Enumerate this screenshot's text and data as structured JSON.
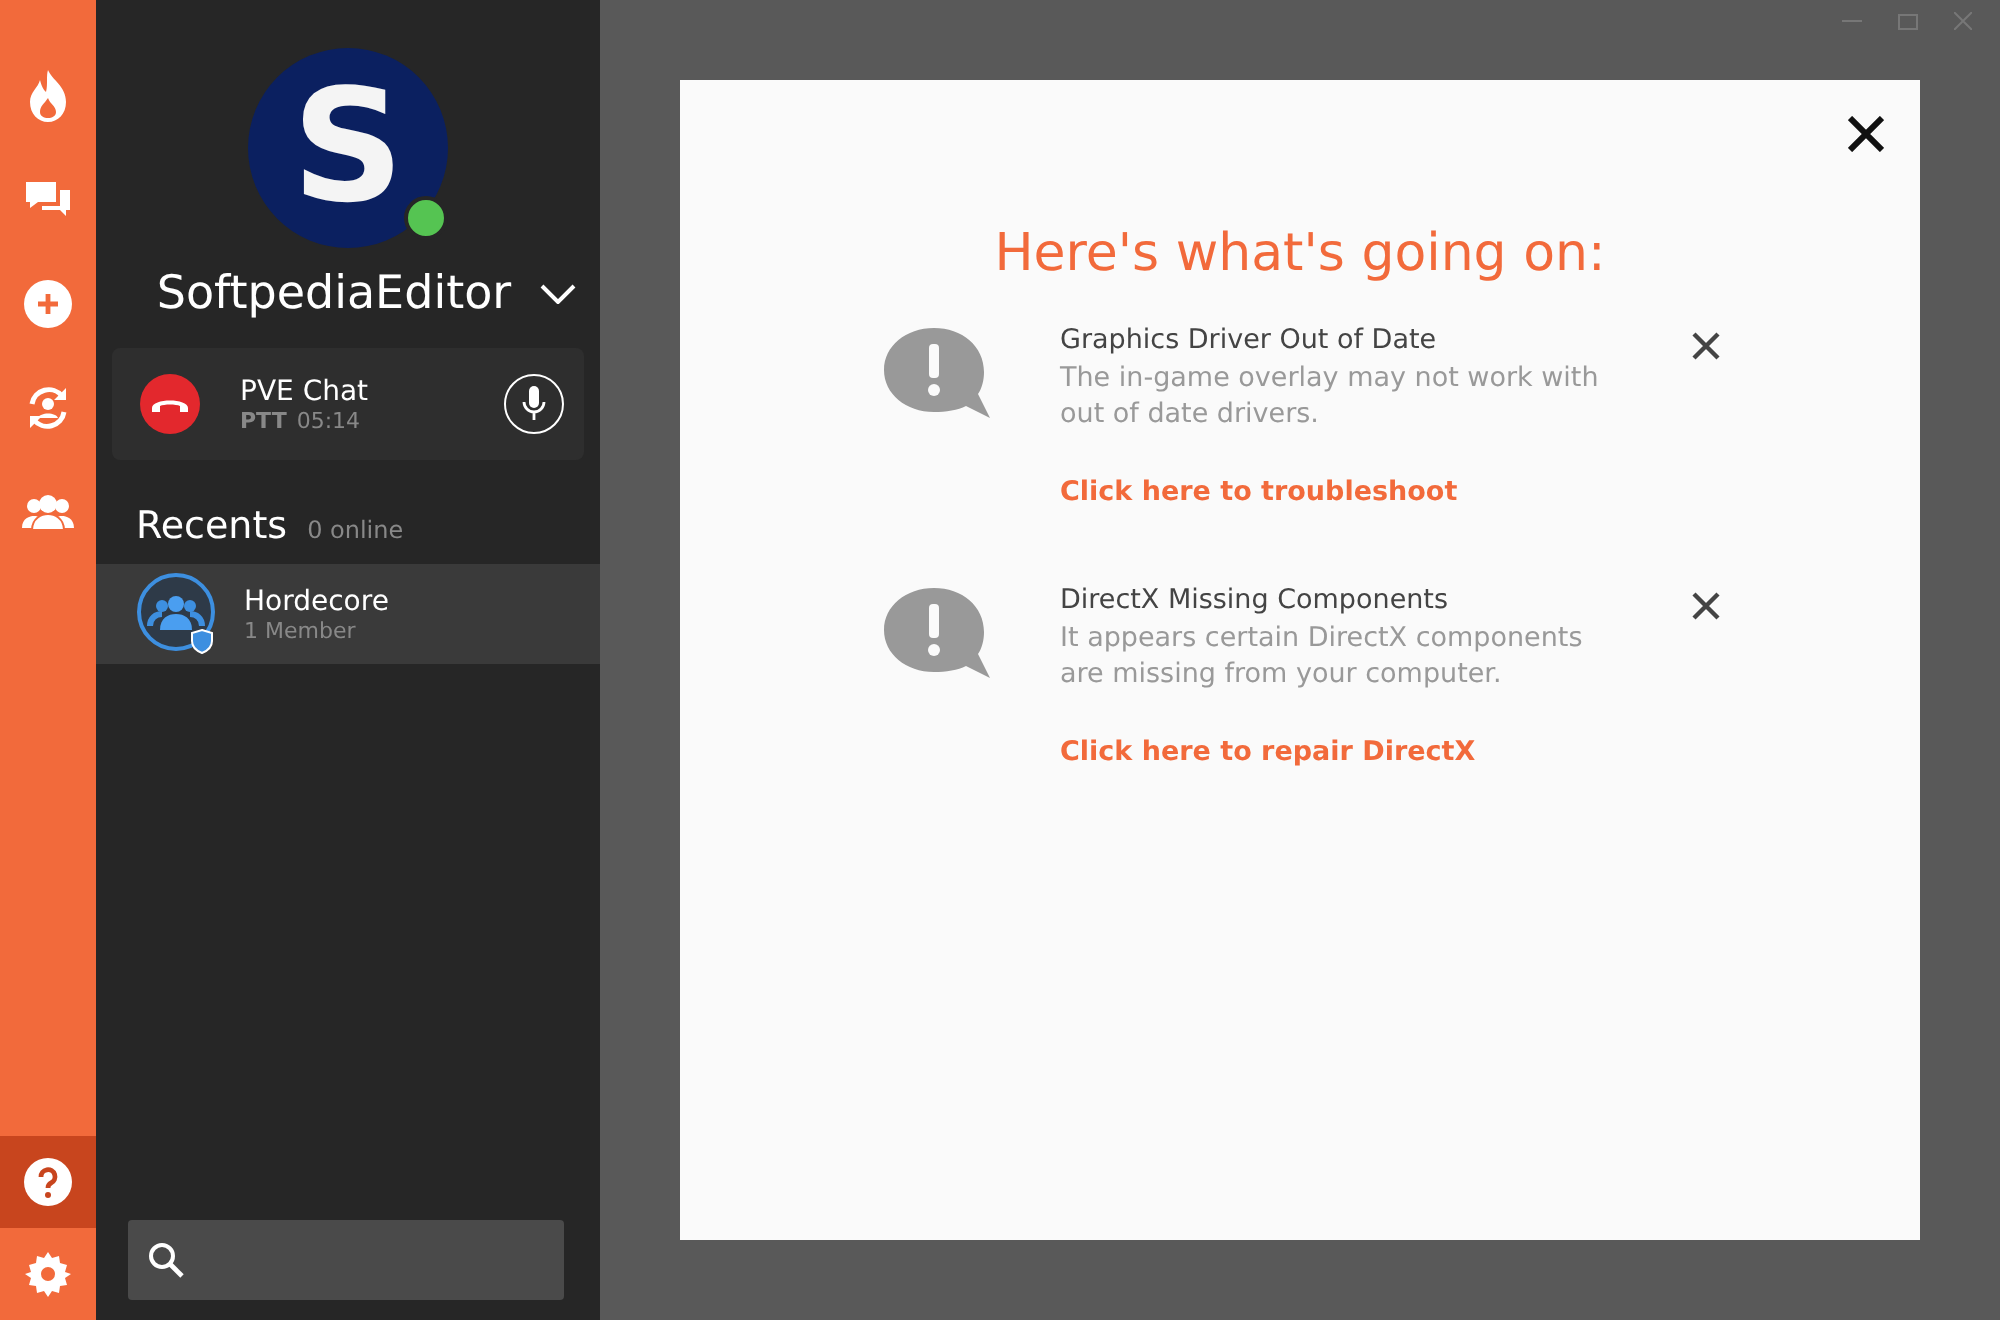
{
  "rail": {
    "items": [
      {
        "kind": "flame",
        "selected": false
      },
      {
        "kind": "chat",
        "selected": false
      },
      {
        "kind": "add",
        "selected": false
      },
      {
        "kind": "sync",
        "selected": false
      },
      {
        "kind": "group",
        "selected": false
      }
    ],
    "bottom_items": [
      {
        "kind": "help",
        "selected": true
      },
      {
        "kind": "settings",
        "selected": false
      }
    ]
  },
  "profile": {
    "avatar_letter": "S",
    "online": true,
    "username": "SoftpediaEditor"
  },
  "call": {
    "channel": "PVE Chat",
    "mode": "PTT",
    "duration": "05:14"
  },
  "recents": {
    "title": "Recents",
    "online_count": "0 online",
    "items": [
      {
        "name": "Hordecore",
        "members": "1 Member",
        "selected": true
      }
    ]
  },
  "dialog": {
    "title": "Here's what's going on:",
    "notices": [
      {
        "title": "Graphics Driver Out of Date",
        "body": "The in-game overlay may not work with out of date drivers.",
        "link": "Click here to troubleshoot"
      },
      {
        "title": "DirectX Missing Components",
        "body": "It appears certain DirectX components are missing from your computer.",
        "link": "Click here to repair DirectX"
      }
    ]
  }
}
